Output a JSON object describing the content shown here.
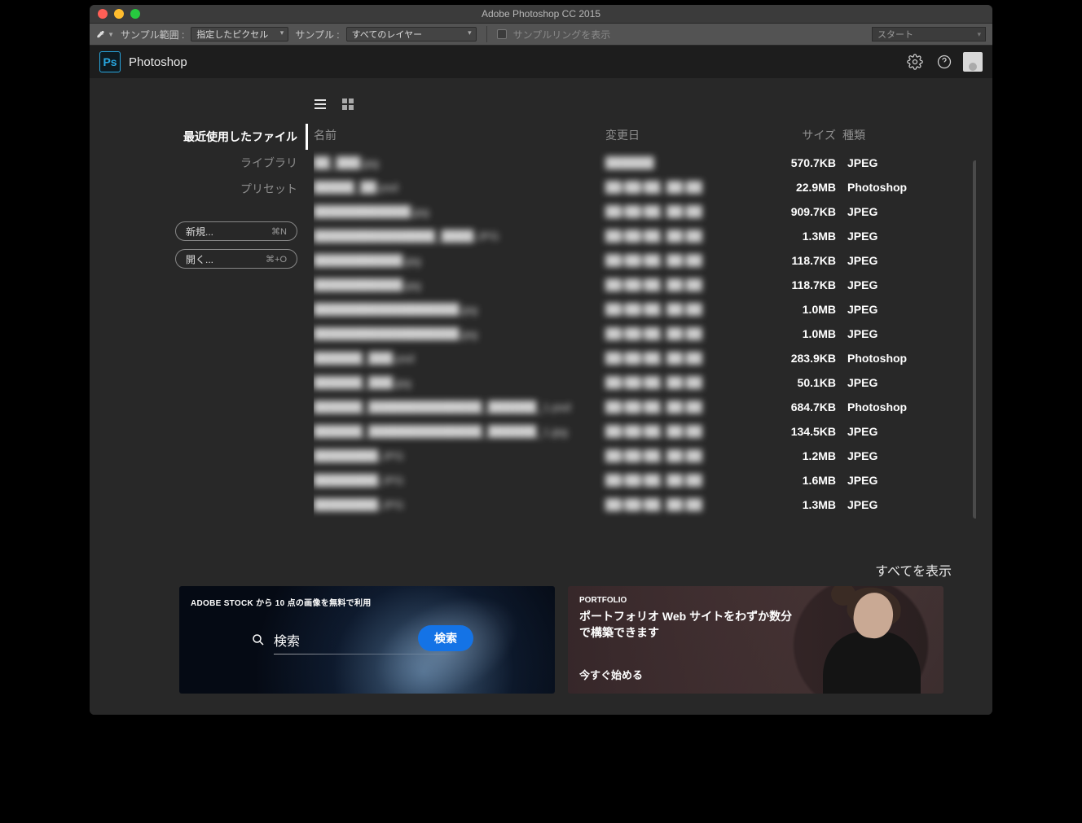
{
  "window": {
    "title": "Adobe Photoshop CC 2015"
  },
  "toolbar": {
    "sample_range_label": "サンプル範囲 :",
    "sample_range_value": "指定したピクセル",
    "sample_label": "サンプル :",
    "sample_value": "すべてのレイヤー",
    "show_ring_label": "サンプルリングを表示",
    "start_label": "スタート"
  },
  "appbar": {
    "product": "Photoshop",
    "badge": "Ps"
  },
  "sidebar": {
    "items": [
      {
        "label": "最近使用したファイル",
        "active": true
      },
      {
        "label": "ライブラリ",
        "active": false
      },
      {
        "label": "プリセット",
        "active": false
      }
    ],
    "new_label": "新規...",
    "new_kbd": "⌘N",
    "open_label": "開く...",
    "open_kbd": "⌘+O"
  },
  "table": {
    "headers": {
      "name": "名前",
      "modified": "変更日",
      "size": "サイズ",
      "kind": "種類"
    },
    "rows": [
      {
        "name": "██_███.jpg",
        "date": "██████",
        "size": "570.7KB",
        "kind": "JPEG"
      },
      {
        "name": "█████_██.psd",
        "date": "██/██/██, ██:██",
        "size": "22.9MB",
        "kind": "Photoshop"
      },
      {
        "name": "████████████.jpg",
        "date": "██/██/██, ██:██",
        "size": "909.7KB",
        "kind": "JPEG"
      },
      {
        "name": "███████████████_████.JPG",
        "date": "██/██/██, ██:██",
        "size": "1.3MB",
        "kind": "JPEG"
      },
      {
        "name": "███████████.jpg",
        "date": "██/██/██, ██:██",
        "size": "118.7KB",
        "kind": "JPEG"
      },
      {
        "name": "███████████.jpg",
        "date": "██/██/██, ██:██",
        "size": "118.7KB",
        "kind": "JPEG"
      },
      {
        "name": "██████████████████.jpg",
        "date": "██/██/██, ██:██",
        "size": "1.0MB",
        "kind": "JPEG"
      },
      {
        "name": "██████████████████.jpg",
        "date": "██/██/██, ██:██",
        "size": "1.0MB",
        "kind": "JPEG"
      },
      {
        "name": "██████_███.psd",
        "date": "██/██/██, ██:██",
        "size": "283.9KB",
        "kind": "Photoshop"
      },
      {
        "name": "██████_███.jpg",
        "date": "██/██/██, ██:██",
        "size": "50.1KB",
        "kind": "JPEG"
      },
      {
        "name": "██████_██████████████_██████_1.psd",
        "date": "██/██/██, ██:██",
        "size": "684.7KB",
        "kind": "Photoshop"
      },
      {
        "name": "██████_██████████████_██████_1.jpg",
        "date": "██/██/██, ██:██",
        "size": "134.5KB",
        "kind": "JPEG"
      },
      {
        "name": "████████.JPG",
        "date": "██/██/██, ██:██",
        "size": "1.2MB",
        "kind": "JPEG"
      },
      {
        "name": "████████.JPG",
        "date": "██/██/██, ██:██",
        "size": "1.6MB",
        "kind": "JPEG"
      },
      {
        "name": "████████.JPG",
        "date": "██/██/██, ██:██",
        "size": "1.3MB",
        "kind": "JPEG"
      }
    ]
  },
  "showall_label": "すべてを表示",
  "promo1": {
    "headline": "ADOBE STOCK から 10 点の画像を無料で利用",
    "search_placeholder": "検索",
    "button": "検索"
  },
  "promo2": {
    "tag": "PORTFOLIO",
    "title": "ポートフォリオ Web サイトをわずか数分で構築できます",
    "cta": "今すぐ始める"
  }
}
